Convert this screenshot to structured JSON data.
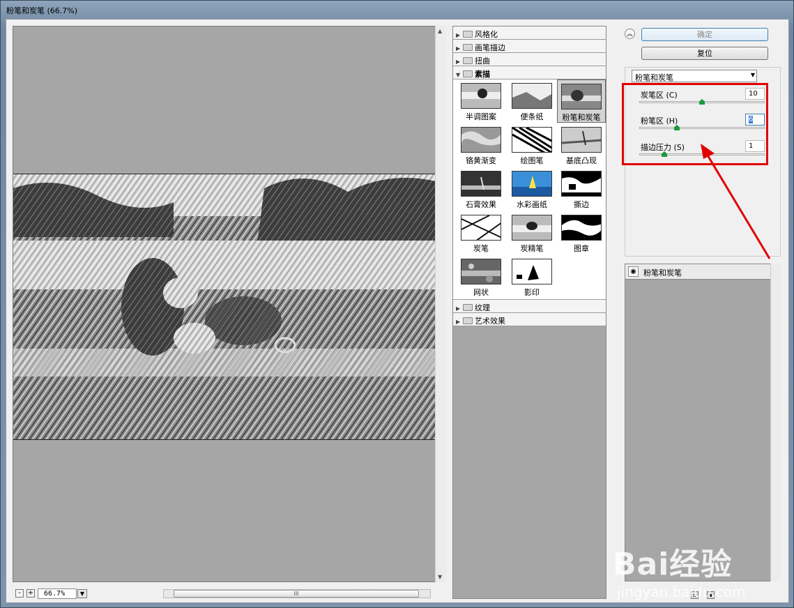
{
  "window": {
    "title": "粉笔和炭笔 (66.7%)"
  },
  "preview": {
    "zoom": "66.7%",
    "zoom_out": "-",
    "zoom_in": "+",
    "scroll_grip": "III"
  },
  "filters": {
    "categories_top": [
      {
        "label": "风格化",
        "expanded": false
      },
      {
        "label": "画笔描边",
        "expanded": false
      },
      {
        "label": "扭曲",
        "expanded": false
      },
      {
        "label": "素描",
        "expanded": true
      }
    ],
    "sketch_items": [
      {
        "label": "半调图案",
        "selected": false
      },
      {
        "label": "便条纸",
        "selected": false
      },
      {
        "label": "粉笔和炭笔",
        "selected": true
      },
      {
        "label": "铬黄渐变",
        "selected": false
      },
      {
        "label": "绘图笔",
        "selected": false
      },
      {
        "label": "基底凸现",
        "selected": false
      },
      {
        "label": "石膏效果",
        "selected": false
      },
      {
        "label": "水彩画纸",
        "selected": false
      },
      {
        "label": "撕边",
        "selected": false
      },
      {
        "label": "炭笔",
        "selected": false
      },
      {
        "label": "炭精笔",
        "selected": false
      },
      {
        "label": "图章",
        "selected": false
      },
      {
        "label": "网状",
        "selected": false
      },
      {
        "label": "影印",
        "selected": false
      }
    ],
    "categories_bottom": [
      {
        "label": "纹理",
        "expanded": false
      },
      {
        "label": "艺术效果",
        "expanded": false
      }
    ]
  },
  "buttons": {
    "ok": "确定",
    "reset": "复位"
  },
  "options": {
    "selected_filter": "粉笔和炭笔",
    "params": [
      {
        "label": "炭笔区 (C)",
        "value": "10",
        "slider_fraction": 0.5
      },
      {
        "label": "粉笔区 (H)",
        "value": "6",
        "slider_fraction": 0.3
      },
      {
        "label": "描边压力 (S)",
        "value": "1",
        "slider_fraction": 0.2
      }
    ]
  },
  "layers": [
    {
      "label": "粉笔和炭笔",
      "visible": true
    }
  ],
  "watermark": {
    "brand": "Bai经验",
    "url": "jingyan.baidu.com"
  },
  "colors": {
    "annotation": "#e00000",
    "preview_bg": "#a6a6a6",
    "slider_knob": "#1a9a3a"
  }
}
